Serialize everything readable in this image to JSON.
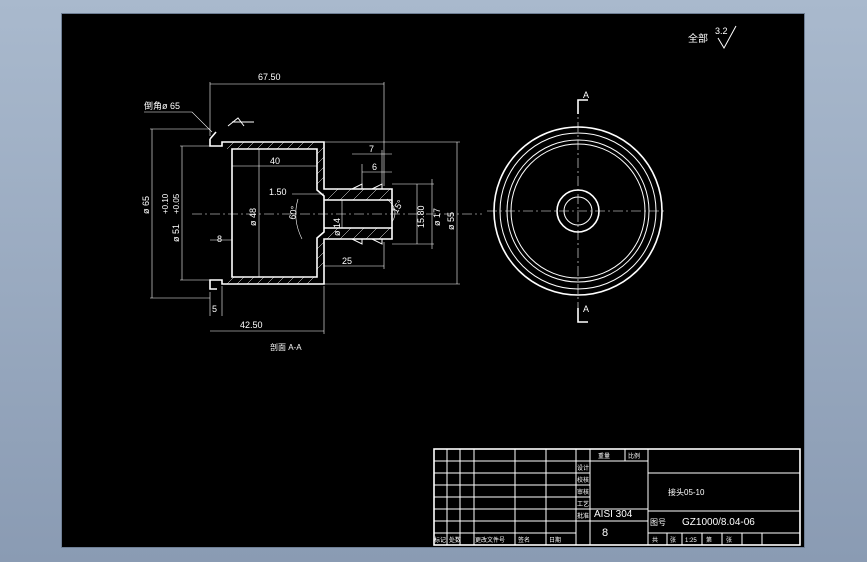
{
  "roughness": {
    "label": "全部",
    "value": "3.2"
  },
  "section_view": {
    "dims": {
      "d_overall_length": "67.50",
      "d_chamfer": "倒角",
      "d_dia_flange": "ø 65",
      "d_dia_65": "ø 65",
      "d_tol_upper": "+0.10",
      "d_tol_lower": "+0.05",
      "d_dia_51": "ø 51",
      "d_dia_48": "ø 48",
      "d_len_40": "40",
      "d_len_7": "7",
      "d_len_6": "6",
      "d_len_150": "1.50",
      "d_angle_60": "60°",
      "d_dia_14": "ø 14",
      "d_angle_15": "15°",
      "d_dia_1580": "15.80",
      "d_dia_17": "ø 17",
      "d_dia_55": "ø 55",
      "d_len_8": "8",
      "d_len_25": "25",
      "d_len_5": "5",
      "d_len_4250": "42.50"
    },
    "caption": "剖面 A-A"
  },
  "end_view": {
    "section_mark_top": "A",
    "section_mark_bottom": "A"
  },
  "title_block": {
    "part_name": "接头05-10",
    "material": "AISI 304",
    "quantity": "8",
    "drawing_no_label": "图号",
    "drawing_no": "GZ1000/8.04-06",
    "header_cells": [
      "标记",
      "处数",
      "更改文件号",
      "签名",
      "日期"
    ],
    "col_labels": [
      "设计",
      "校核",
      "审核",
      "工艺",
      "批准"
    ],
    "small_labels": [
      "重量",
      "比例"
    ],
    "bottom_row": [
      "共",
      "张",
      "1:25",
      "第",
      "张"
    ]
  }
}
